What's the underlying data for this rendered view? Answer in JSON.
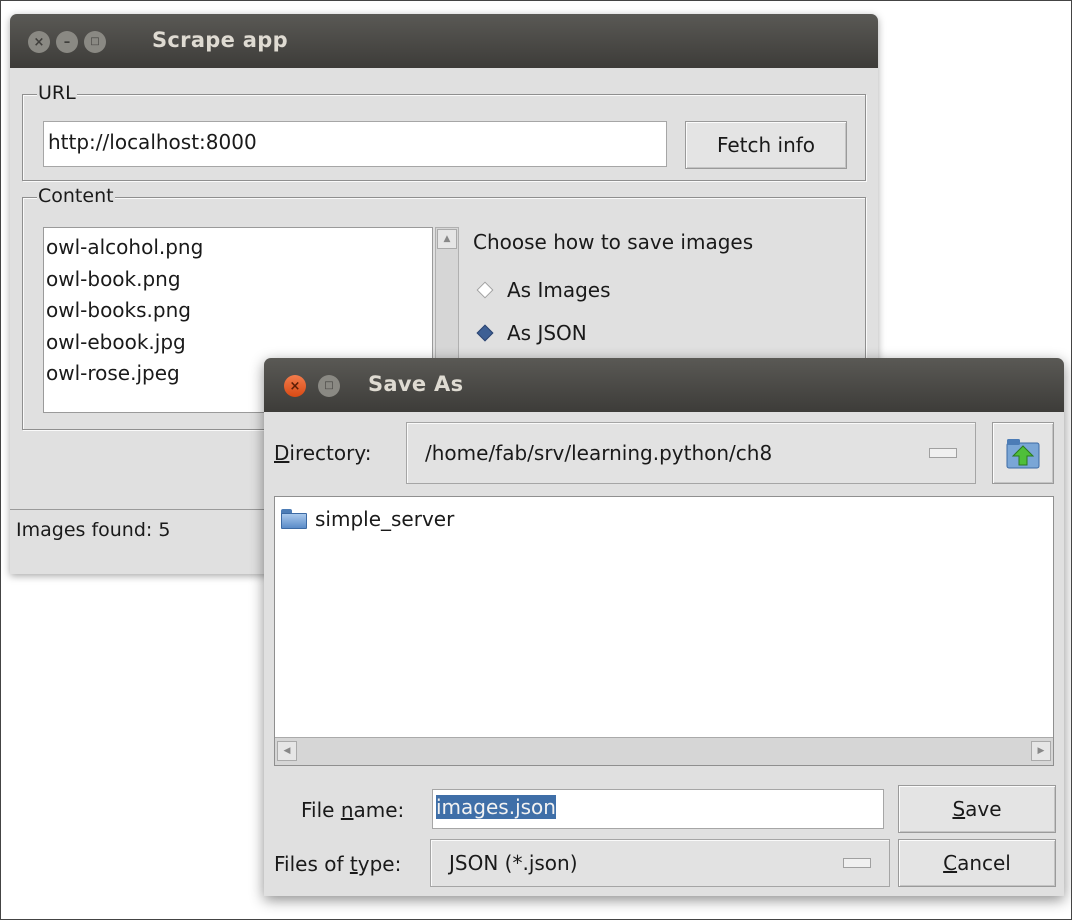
{
  "scrape_window": {
    "title": "Scrape app",
    "url_group": {
      "label": "URL",
      "url_value": "http://localhost:8000",
      "fetch_button": "Fetch info"
    },
    "content_group": {
      "label": "Content",
      "files": [
        "owl-alcohol.png",
        "owl-book.png",
        "owl-books.png",
        "owl-ebook.jpg",
        "owl-rose.jpeg"
      ],
      "save_heading": "Choose how to save images",
      "options": [
        {
          "label": "As Images",
          "selected": false
        },
        {
          "label": "As JSON",
          "selected": true
        }
      ]
    },
    "status": "Images found: 5"
  },
  "save_dialog": {
    "title": "Save As",
    "directory": {
      "label_first": "D",
      "label_rest": "irectory:",
      "value": "/home/fab/srv/learning.python/ch8"
    },
    "files": [
      {
        "name": "simple_server",
        "type": "folder"
      }
    ],
    "filename": {
      "label_pre": "File ",
      "label_ul": "n",
      "label_post": "ame:",
      "value": "images.json"
    },
    "filetype": {
      "label_pre": "Files of ",
      "label_ul": "t",
      "label_post": "ype:",
      "value": "JSON (*.json)"
    },
    "save_button": {
      "ul": "S",
      "rest": "ave"
    },
    "cancel_button": {
      "ul": "C",
      "rest": "ancel"
    }
  },
  "colors": {
    "window_bg": "#e0e0e0",
    "titlebar": "#3d3c39",
    "selection": "#3f6fa8",
    "close_button": "#e0551f"
  }
}
